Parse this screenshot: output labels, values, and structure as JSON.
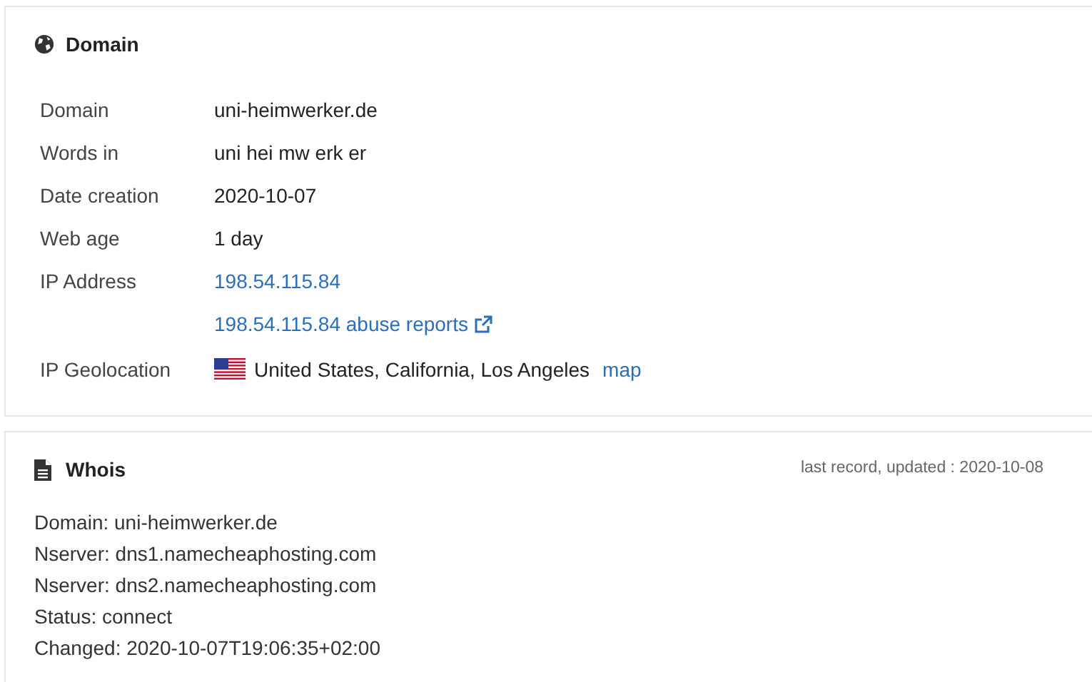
{
  "domain_panel": {
    "title": "Domain",
    "rows": [
      {
        "kind": "text",
        "label": "Domain",
        "value": "uni-heimwerker.de"
      },
      {
        "kind": "text",
        "label": "Words in",
        "value": "uni hei mw erk er"
      },
      {
        "kind": "text",
        "label": "Date creation",
        "value": "2020-10-07"
      },
      {
        "kind": "text",
        "label": "Web age",
        "value": "1 day"
      },
      {
        "kind": "link",
        "label": "IP Address",
        "value": "198.54.115.84"
      },
      {
        "kind": "external_link",
        "value": "198.54.115.84 abuse reports"
      },
      {
        "kind": "geolocation",
        "label": "IP Geolocation",
        "value": "United States, California, Los Angeles",
        "link": "map"
      }
    ]
  },
  "whois_panel": {
    "title": "Whois",
    "updated": "last record, updated : 2020-10-08",
    "lines": [
      "Domain: uni-heimwerker.de",
      "Nserver: dns1.namecheaphosting.com",
      "Nserver: dns2.namecheaphosting.com",
      "Status: connect",
      "Changed: 2020-10-07T19:06:35+02:00"
    ]
  }
}
